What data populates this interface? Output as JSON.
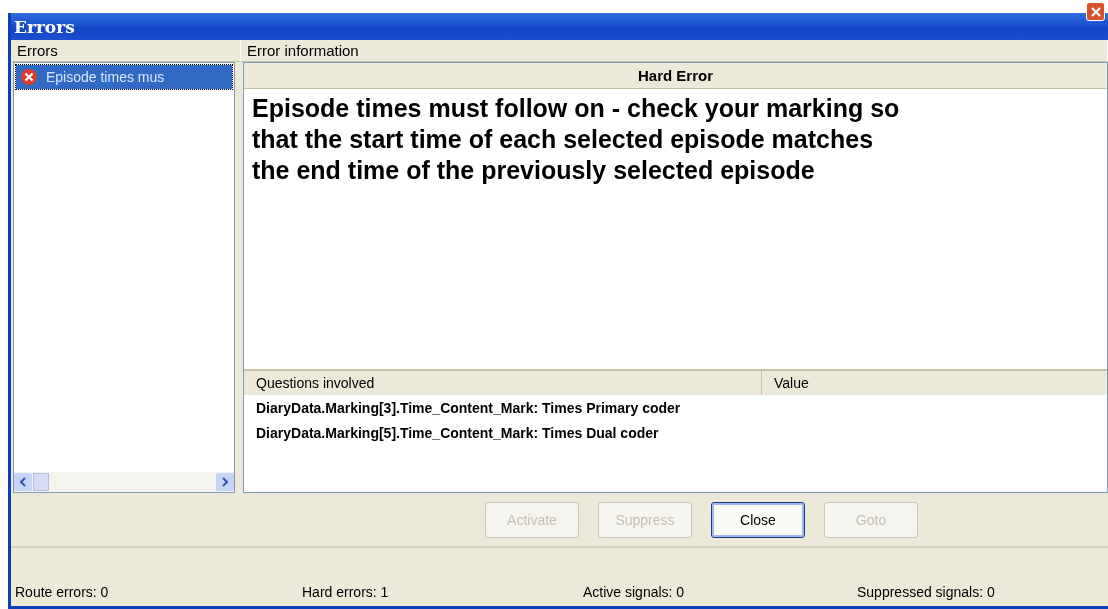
{
  "window": {
    "title": "Errors"
  },
  "errors_panel": {
    "header": "Errors",
    "items": [
      {
        "text": "Episode times mus",
        "selected": true
      }
    ]
  },
  "info_panel": {
    "header": "Error information",
    "severity": "Hard Error",
    "message": "Episode times must follow on - check your marking so that the start time of each selected episode matches the end time of the previously selected episode",
    "table": {
      "columns": [
        "Questions involved",
        "Value"
      ],
      "rows": [
        [
          "DiaryData.Marking[3].Time_Content_Mark: Times Primary coder"
        ],
        [
          "DiaryData.Marking[5].Time_Content_Mark: Times Dual coder"
        ]
      ]
    }
  },
  "buttons": [
    {
      "label": "Activate",
      "disabled": true,
      "default": false
    },
    {
      "label": "Suppress",
      "disabled": true,
      "default": false
    },
    {
      "label": "Close",
      "disabled": false,
      "default": true
    },
    {
      "label": "Goto",
      "disabled": true,
      "default": false
    }
  ],
  "status_bar": [
    "Route errors: 0",
    "Hard errors: 1",
    "Active signals: 0",
    "Suppressed signals: 0"
  ]
}
